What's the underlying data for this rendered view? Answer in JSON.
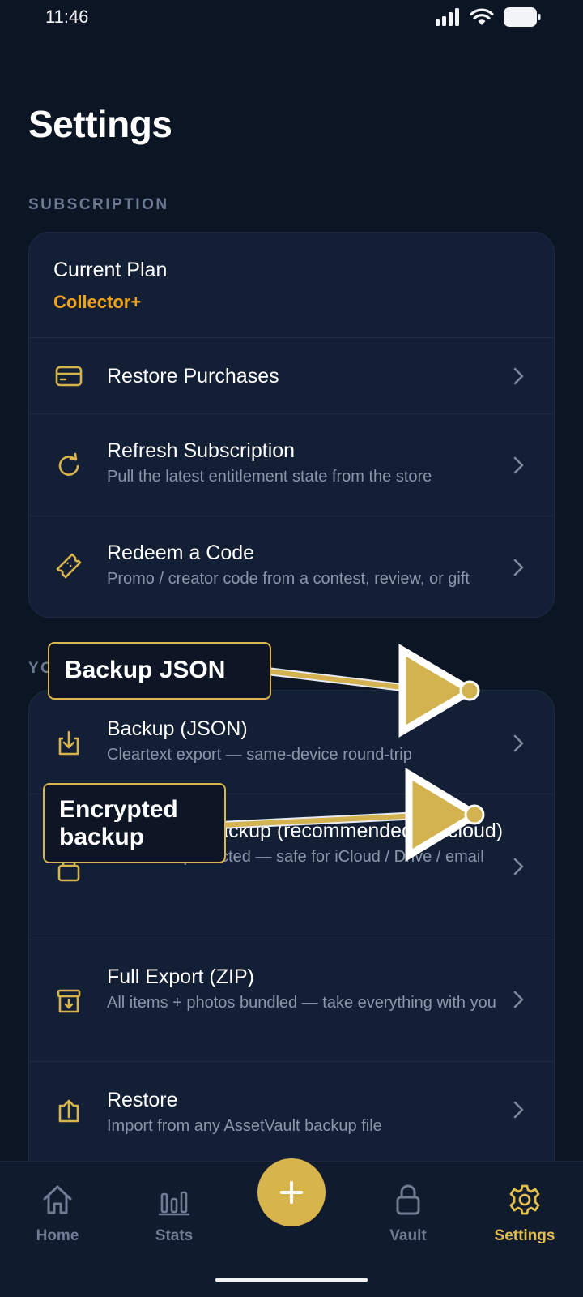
{
  "status": {
    "time": "11:46"
  },
  "page": {
    "title": "Settings"
  },
  "subscription": {
    "section_label": "SUBSCRIPTION",
    "plan_title": "Current Plan",
    "plan_value": "Collector+",
    "rows": [
      {
        "icon": "credit-card-icon",
        "title": "Restore Purchases",
        "subtitle": ""
      },
      {
        "icon": "refresh-icon",
        "title": "Refresh Subscription",
        "subtitle": "Pull the latest entitlement state from the store"
      },
      {
        "icon": "ticket-icon",
        "title": "Redeem a Code",
        "subtitle": "Promo / creator code from a contest, review, or gift"
      }
    ]
  },
  "data_section": {
    "section_label": "YO",
    "rows": [
      {
        "icon": "download-icon",
        "title": "Backup (JSON)",
        "subtitle": "Cleartext export — same-device round-trip"
      },
      {
        "icon": "lock-icon",
        "title": "Encrypted Backup (recommended for cloud)",
        "subtitle": "Password-protected — safe for iCloud / Drive / email"
      },
      {
        "icon": "archive-icon",
        "title": "Full Export (ZIP)",
        "subtitle": "All items + photos bundled — take everything with you"
      },
      {
        "icon": "upload-icon",
        "title": "Restore",
        "subtitle": "Import from any AssetVault backup file"
      }
    ]
  },
  "annotations": {
    "backup_json": "Backup JSON",
    "encrypted_backup": "Encrypted backup"
  },
  "tabbar": {
    "home": "Home",
    "stats": "Stats",
    "vault": "Vault",
    "settings": "Settings",
    "active": "settings"
  },
  "colors": {
    "background": "#0c1524",
    "card": "#131f35",
    "accent_gold": "#d8b44d",
    "plan_orange": "#f0a21b"
  }
}
